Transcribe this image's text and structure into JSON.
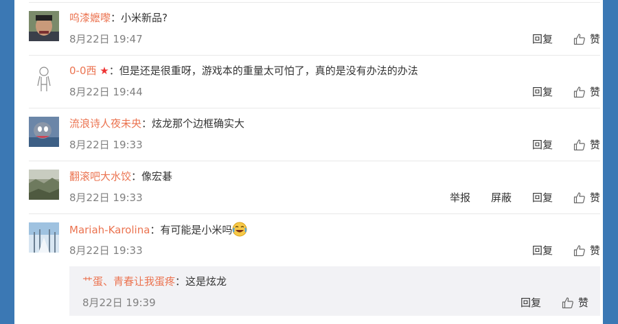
{
  "comments": [
    {
      "username": "呜漆嬷嚟",
      "text": "小米新品?",
      "time": "8月22日 19:47",
      "actions": [
        "回复",
        "赞"
      ]
    },
    {
      "username": "0-0西",
      "badge": "★",
      "text": "但是还是很重呀，游戏本的重量太可怕了，真的是没有办法的办法",
      "time": "8月22日 19:44",
      "actions": [
        "回复",
        "赞"
      ]
    },
    {
      "username": "流浪诗人夜未央",
      "text": "炫龙那个边框确实大",
      "time": "8月22日 19:33",
      "actions": [
        "回复",
        "赞"
      ]
    },
    {
      "username": "翻滚吧大水饺",
      "text": "像宏碁",
      "time": "8月22日 19:33",
      "actions": [
        "举报",
        "屏蔽",
        "回复",
        "赞"
      ]
    },
    {
      "username": "Mariah-Karolina",
      "text": "有可能是小米吗",
      "emoji": "laugh-cry-emoji",
      "time": "8月22日 19:33",
      "actions": [
        "回复",
        "赞"
      ]
    }
  ],
  "reply": {
    "username": "艹蛋、青春让我蛋疼",
    "text": "这是炫龙",
    "time": "8月22日 19:39",
    "actions": [
      "回复",
      "赞"
    ]
  },
  "separator": "：",
  "colors": {
    "username": "#eb7350",
    "time": "#808080",
    "background": "#3b78b4"
  }
}
